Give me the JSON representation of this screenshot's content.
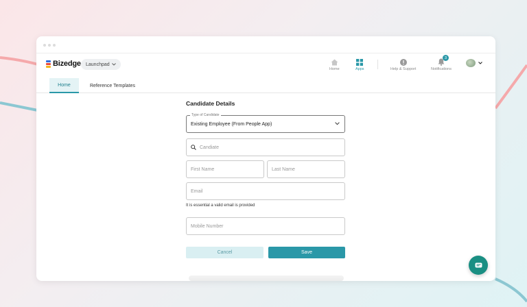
{
  "brand": {
    "name": "Bizedge",
    "colors": [
      "#2f6fe0",
      "#e94a3c",
      "#f2b51b"
    ]
  },
  "launchpad": {
    "label": "Launchpad",
    "icon": "chevron-down-icon"
  },
  "topnav": [
    {
      "label": "Home",
      "icon": "home-icon",
      "active": false
    },
    {
      "label": "Apps",
      "icon": "apps-grid-icon",
      "active": true
    },
    {
      "label": "Help & Support",
      "icon": "info-icon",
      "active": false
    },
    {
      "label": "Notifications",
      "icon": "bell-icon",
      "active": false,
      "badge": "3"
    }
  ],
  "profile": {
    "icon": "avatar",
    "menu_icon": "chevron-down-icon"
  },
  "tabs": [
    {
      "label": "Home",
      "active": true
    },
    {
      "label": "Reference Templates",
      "active": false
    }
  ],
  "form": {
    "title": "Candidate Details",
    "type_of_candidate": {
      "label": "Type of Candidate",
      "value": "Existing Employee (From People App)"
    },
    "candidate": {
      "placeholder": "Candiate"
    },
    "first_name": {
      "placeholder": "First Name"
    },
    "last_name": {
      "placeholder": "Last Name"
    },
    "email": {
      "placeholder": "Email"
    },
    "email_hint": "It is essential a valid email is provided",
    "mobile": {
      "placeholder": "Mobile Number"
    },
    "cancel_label": "Cancel",
    "save_label": "Save"
  },
  "chat": {
    "icon": "chat-icon"
  },
  "colors": {
    "accent": "#2a98a8",
    "accent_light": "#d9eff2",
    "chat": "#1a8f83"
  }
}
